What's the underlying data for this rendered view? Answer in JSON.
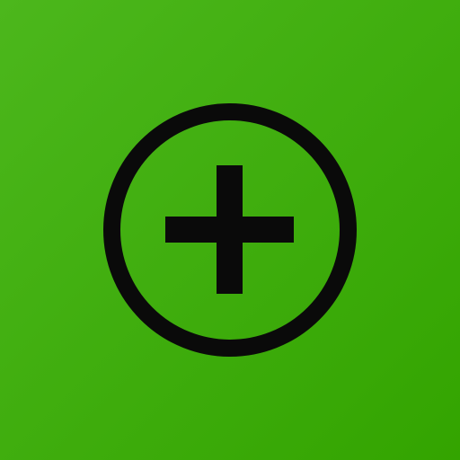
{
  "icon": {
    "name": "add-circle-icon",
    "background_top_color": "#4cb71c",
    "background_bottom_color": "#33a400",
    "glyph_color": "#0a0a0a"
  }
}
